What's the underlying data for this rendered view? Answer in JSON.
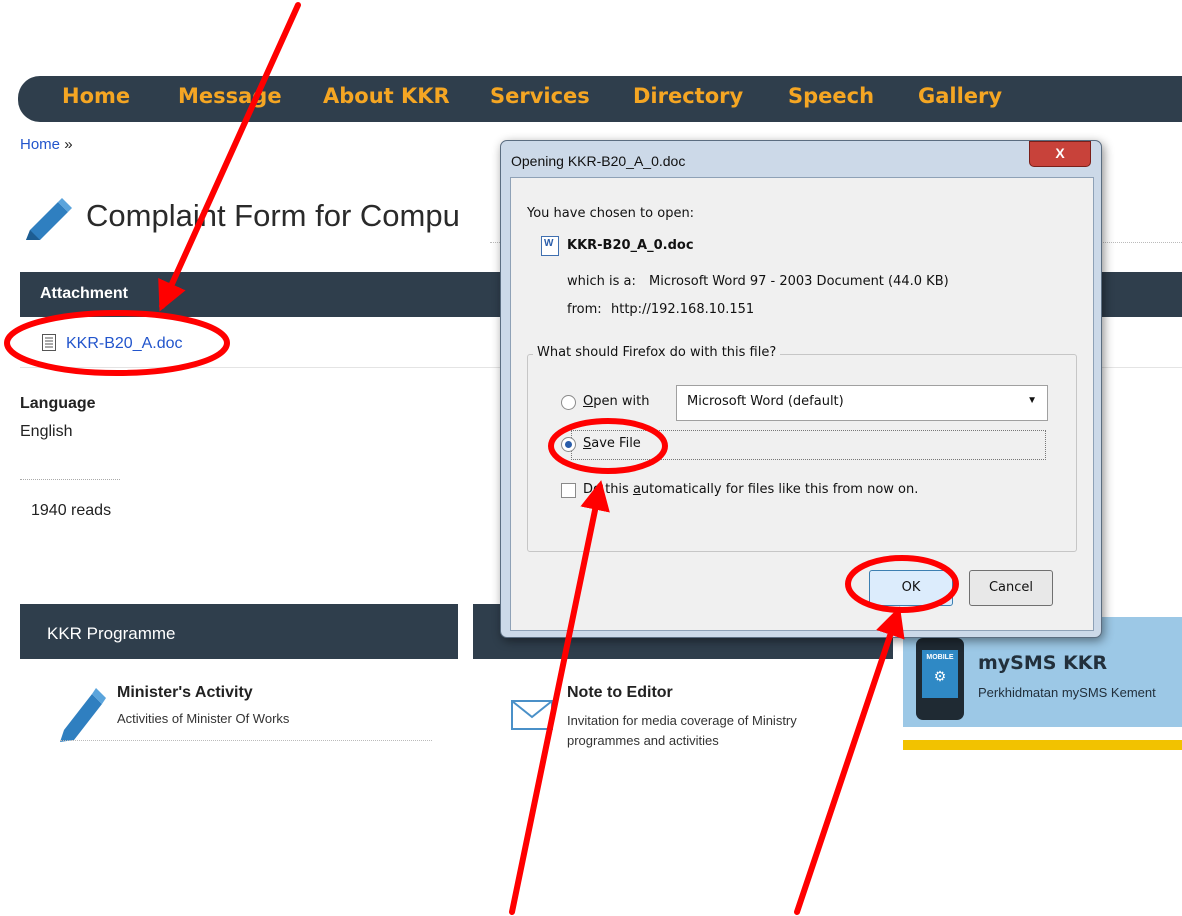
{
  "nav": {
    "items": [
      "Home",
      "Message",
      "About KKR",
      "Services",
      "Directory",
      "Speech",
      "Gallery"
    ]
  },
  "breadcrumb": {
    "home": "Home",
    "sep": "»"
  },
  "page": {
    "title": "Complaint Form for Compu",
    "attachment_header": "Attachment",
    "attachment_link": "KKR-B20_A.doc",
    "language_label": "Language",
    "language_value": "English",
    "reads": "1940 reads"
  },
  "programme": {
    "header": "KKR Programme",
    "minister_title": "Minister's Activity",
    "minister_sub": "Activities of Minister Of Works",
    "editor_title": "Note to Editor",
    "editor_sub": "Invitation for media coverage of Ministry programmes and activities"
  },
  "sms": {
    "phone_label": "MOBILE",
    "title": "mySMS KKR",
    "sub": "Perkhidmatan mySMS Kement"
  },
  "dialog": {
    "title": "Opening KKR-B20_A_0.doc",
    "close_label": "X",
    "chosen": "You have chosen to open:",
    "file_name": "KKR-B20_A_0.doc",
    "which_label": "which is a:",
    "which_value": "Microsoft Word 97 - 2003 Document (44.0 KB)",
    "from_label": "from:",
    "from_value": "http://192.168.10.151",
    "question": "What should Firefox do with this file?",
    "open_with_u": "O",
    "open_with_rest": "pen with",
    "open_with_app": "Microsoft Word (default)",
    "save_u": "S",
    "save_rest": "ave File",
    "auto_pre": "Do this ",
    "auto_u": "a",
    "auto_rest": "utomatically for files like this from now on.",
    "ok": "OK",
    "cancel": "Cancel"
  },
  "colors": {
    "navbar_bg": "#2f3e4c",
    "nav_text": "#f5a623",
    "link": "#2255cc",
    "annotation": "#ff0000"
  }
}
